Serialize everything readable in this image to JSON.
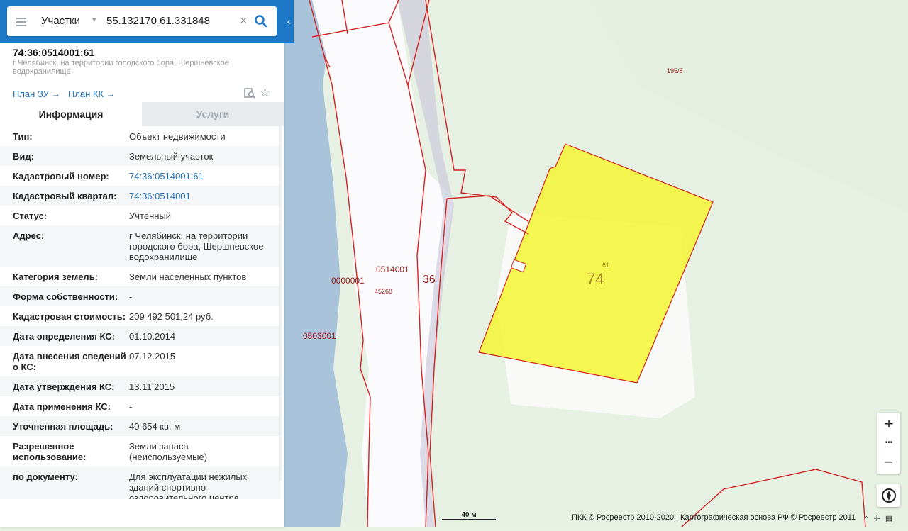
{
  "search": {
    "layer": "Участки",
    "query": "55.132170 61.331848"
  },
  "object": {
    "cadastral_number": "74:36:0514001:61",
    "address_line": "г Челябинск, на территории городского бора, Шершневское водохранилище",
    "plan_zu": "План ЗУ",
    "plan_kk": "План КК"
  },
  "tabs": {
    "info": "Информация",
    "services": "Услуги"
  },
  "rows": [
    {
      "k": "Тип:",
      "v": "Объект недвижимости"
    },
    {
      "k": "Вид:",
      "v": "Земельный участок"
    },
    {
      "k": "Кадастровый номер:",
      "v": "74:36:0514001:61"
    },
    {
      "k": "Кадастровый квартал:",
      "v": "74:36:0514001"
    },
    {
      "k": "Статус:",
      "v": "Учтенный"
    },
    {
      "k": "Адрес:",
      "v": "г Челябинск, на территории городского бора, Шершневское водохранилище"
    },
    {
      "k": "Категория земель:",
      "v": "Земли населённых пунктов"
    },
    {
      "k": "Форма собственности:",
      "v": "-"
    },
    {
      "k": "Кадастровая стоимость:",
      "v": "209 492 501,24 руб."
    },
    {
      "k": "Дата определения КС:",
      "v": "01.10.2014"
    },
    {
      "k": "Дата внесения сведений о КС:",
      "v": "07.12.2015"
    },
    {
      "k": "Дата утверждения КС:",
      "v": "13.11.2015"
    },
    {
      "k": "Дата применения КС:",
      "v": "-"
    },
    {
      "k": "Уточненная площадь:",
      "v": "40 654 кв. м"
    },
    {
      "k": "Разрешенное использование:",
      "v": "Земли запаса (неиспользуемые)"
    },
    {
      "k": "по документу:",
      "v": "Для эксплуатации нежилых зданий спортивно-оздоровительного центра"
    }
  ],
  "map": {
    "labels": {
      "l1": "195/8",
      "l2": "0514001",
      "l3": "45268",
      "l4": "0000001",
      "l5": "36",
      "l6": "0503001",
      "parcel_big": "74",
      "parcel_small": "61"
    },
    "scale": "40 м",
    "attribution": "ПКК © Росреестр 2010-2020 | Картографическая основа РФ © Росреестр 2011",
    "colors": {
      "accent": "#1e78c8",
      "parcel_fill": "#f5f532",
      "boundary": "#d42020"
    }
  },
  "controls": {
    "zoom_in": "+",
    "more": "•••",
    "zoom_out": "−"
  }
}
